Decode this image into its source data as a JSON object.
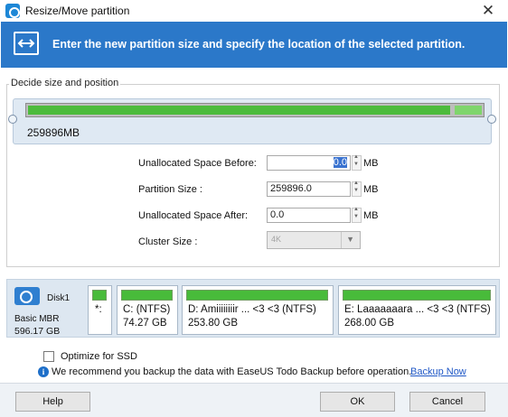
{
  "window": {
    "title": "Resize/Move partition",
    "close_label": "✕"
  },
  "banner": {
    "text": "Enter the new partition size and specify the location of the selected partition.",
    "icon": "resize-arrows-icon"
  },
  "size_section": {
    "legend": "Decide size and position",
    "bar_size_label": "259896MB",
    "used_fraction": 0.93
  },
  "fields": {
    "before": {
      "label": "Unallocated Space Before:",
      "value": "0.0",
      "unit": "MB"
    },
    "partition_size": {
      "label": "Partition Size :",
      "value": "259896.0",
      "unit": "MB"
    },
    "after": {
      "label": "Unallocated Space After:",
      "value": "0.0",
      "unit": "MB"
    },
    "cluster": {
      "label": "Cluster Size :",
      "value": "4K"
    }
  },
  "disk": {
    "name": "Disk1",
    "type": "Basic MBR",
    "size": "596.17 GB",
    "icon": "disk-icon",
    "partitions": [
      {
        "label": "*:",
        "size": ""
      },
      {
        "label": "C: (NTFS)",
        "size": "74.27 GB"
      },
      {
        "label": "D: Amiiiiiiiir ... <3 <3 (NTFS)",
        "size": "253.80 GB"
      },
      {
        "label": "E: Laaaaaaara ... <3 <3 (NTFS)",
        "size": "268.00 GB"
      }
    ]
  },
  "options": {
    "ssd_label": "Optimize for SSD",
    "ssd_checked": false
  },
  "notice": {
    "text": "We recommend you backup the data with EaseUS Todo Backup before operation.",
    "link": "Backup Now"
  },
  "buttons": {
    "help": "Help",
    "ok": "OK",
    "cancel": "Cancel"
  },
  "colors": {
    "banner": "#2b78c9",
    "partition_bar": "#48bb3a",
    "disk_map": "#dde7f1"
  }
}
